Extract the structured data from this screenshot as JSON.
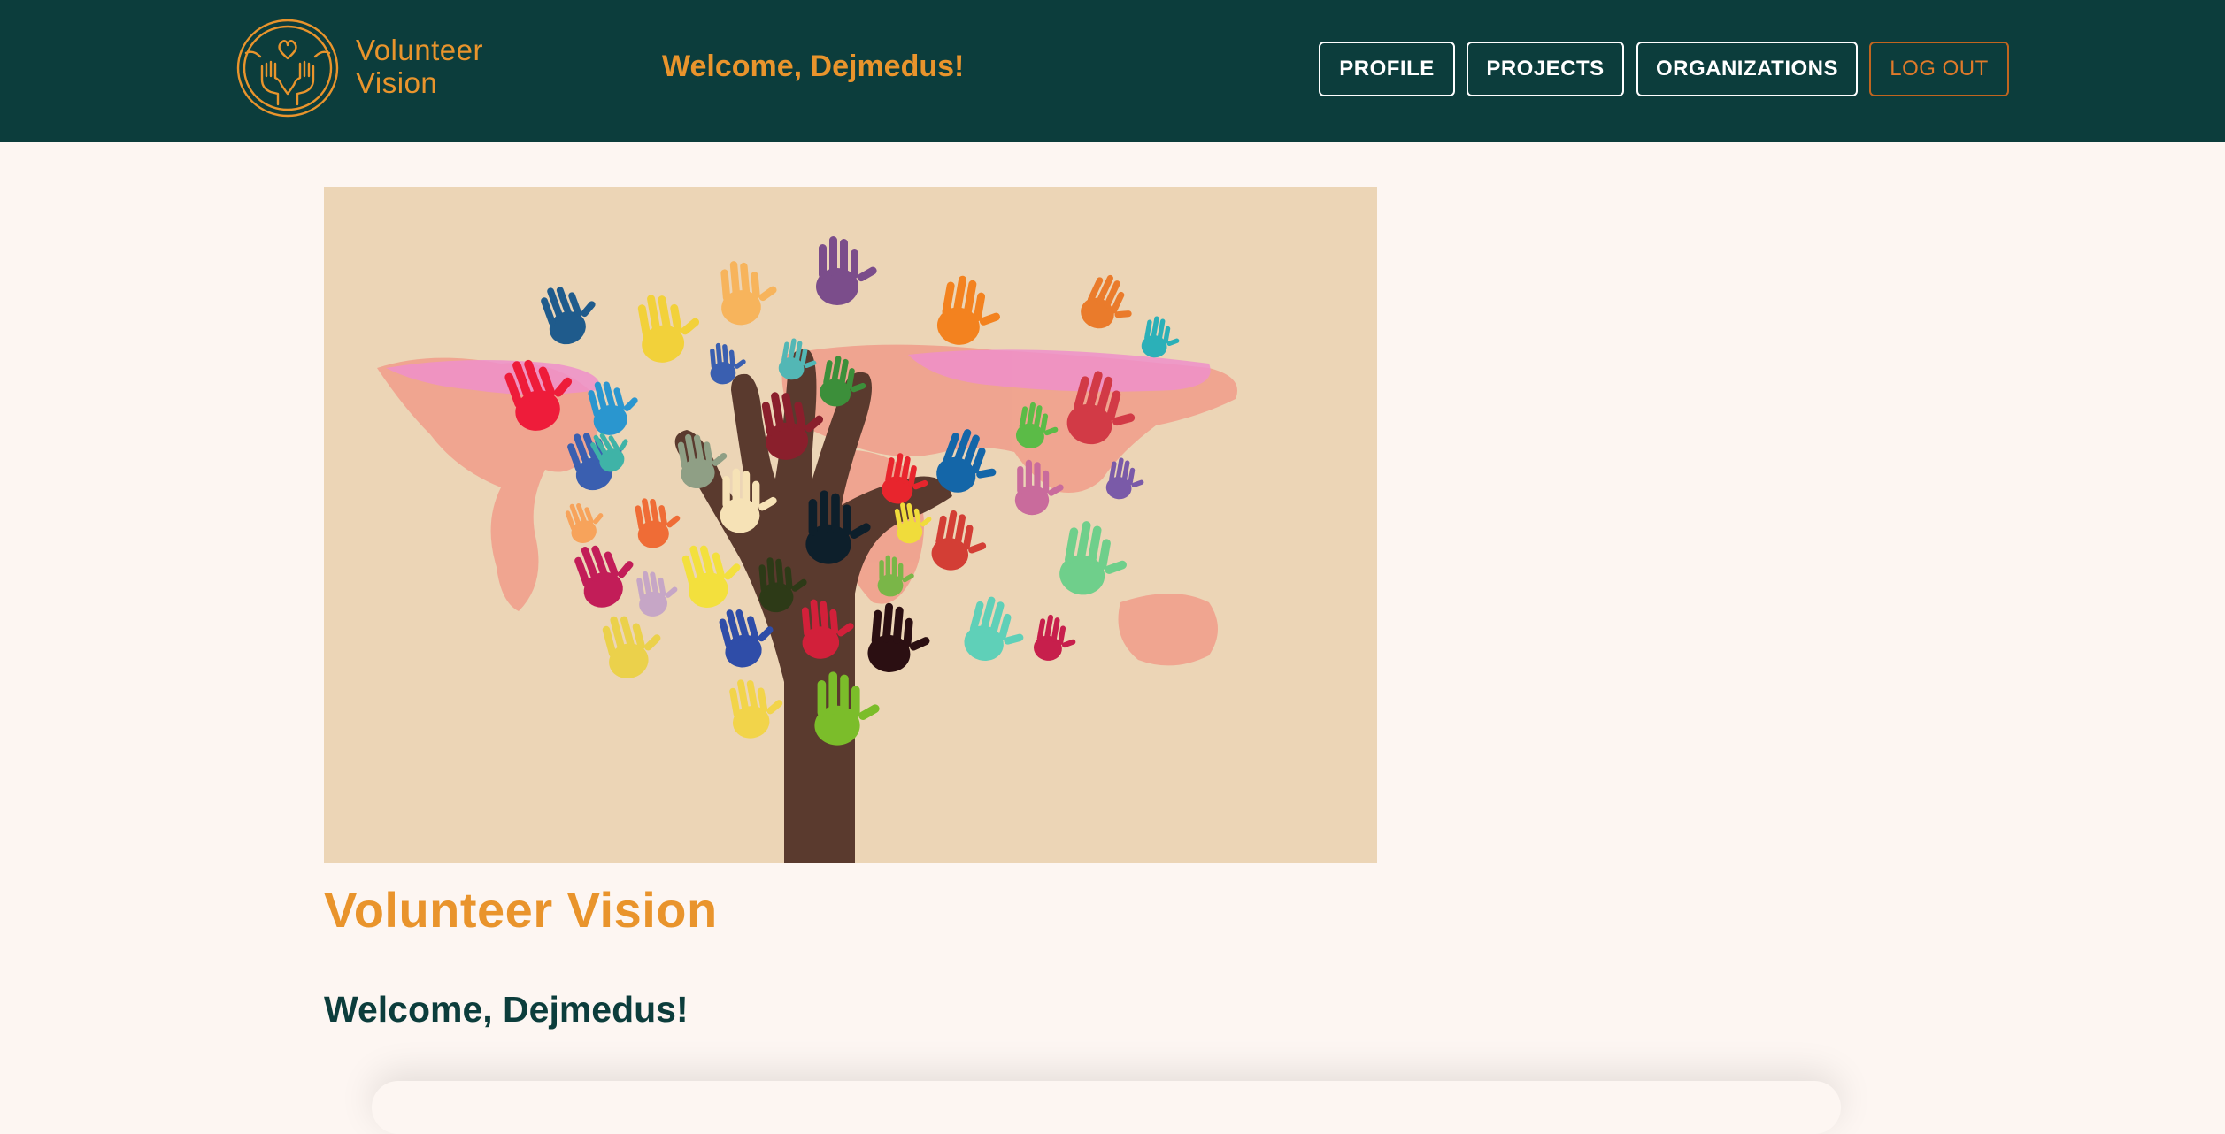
{
  "brand": {
    "name_line1": "Volunteer",
    "name_line2": "Vision",
    "logo_icon": "heart-hands-logo-icon",
    "accent_color": "#e9942c"
  },
  "header": {
    "welcome": "Welcome, Dejmedus!",
    "background_color": "#0c3d3c"
  },
  "nav": {
    "profile": "PROFILE",
    "projects": "PROJECTS",
    "organizations": "ORGANIZATIONS",
    "logout": "LOG OUT"
  },
  "main": {
    "hero_image": "colorful-hands-tree-world-map-illustration",
    "title": "Volunteer Vision",
    "welcome": "Welcome, Dejmedus!"
  }
}
